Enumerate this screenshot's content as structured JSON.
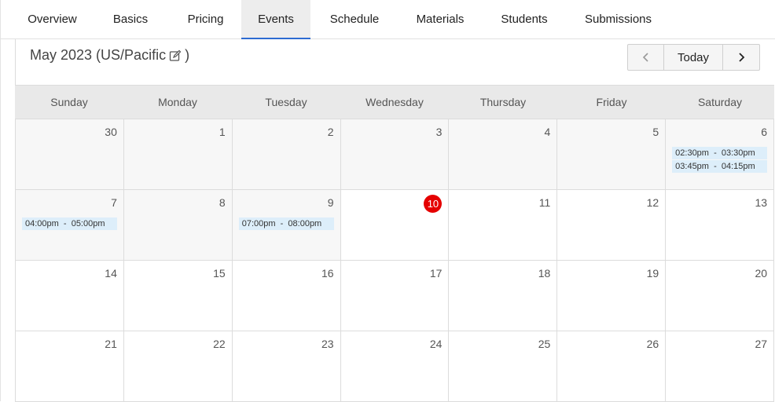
{
  "tabs": [
    "Overview",
    "Basics",
    "Pricing",
    "Events",
    "Schedule",
    "Materials",
    "Students",
    "Submissions"
  ],
  "active_tab": "Events",
  "calendar": {
    "title": "May 2023 (US/Pacific",
    "title_suffix": ")",
    "today_label": "Today",
    "prev_icon": "chevron-left-icon",
    "next_icon": "chevron-right-icon",
    "days_of_week": [
      "Sunday",
      "Monday",
      "Tuesday",
      "Wednesday",
      "Thursday",
      "Friday",
      "Saturday"
    ],
    "weeks": [
      [
        {
          "num": "30",
          "past": true,
          "events": []
        },
        {
          "num": "1",
          "past": true,
          "events": []
        },
        {
          "num": "2",
          "past": true,
          "events": []
        },
        {
          "num": "3",
          "past": true,
          "events": []
        },
        {
          "num": "4",
          "past": true,
          "events": []
        },
        {
          "num": "5",
          "past": true,
          "events": []
        },
        {
          "num": "6",
          "past": true,
          "events": [
            "02:30pm  -  03:30pm",
            "03:45pm  -  04:15pm"
          ]
        }
      ],
      [
        {
          "num": "7",
          "past": true,
          "events": [
            "04:00pm  -  05:00pm"
          ]
        },
        {
          "num": "8",
          "past": true,
          "events": []
        },
        {
          "num": "9",
          "past": true,
          "events": [
            "07:00pm  -  08:00pm"
          ]
        },
        {
          "num": "10",
          "today": true,
          "events": []
        },
        {
          "num": "11",
          "events": []
        },
        {
          "num": "12",
          "events": []
        },
        {
          "num": "13",
          "events": []
        }
      ],
      [
        {
          "num": "14",
          "events": []
        },
        {
          "num": "15",
          "events": []
        },
        {
          "num": "16",
          "events": []
        },
        {
          "num": "17",
          "events": []
        },
        {
          "num": "18",
          "events": []
        },
        {
          "num": "19",
          "events": []
        },
        {
          "num": "20",
          "events": []
        }
      ],
      [
        {
          "num": "21",
          "events": []
        },
        {
          "num": "22",
          "events": []
        },
        {
          "num": "23",
          "events": []
        },
        {
          "num": "24",
          "events": []
        },
        {
          "num": "25",
          "events": []
        },
        {
          "num": "26",
          "events": []
        },
        {
          "num": "27",
          "events": []
        }
      ]
    ]
  },
  "colors": {
    "accent": "#2d6bd1",
    "today": "#e50000",
    "event_bg": "#ddeefa"
  }
}
